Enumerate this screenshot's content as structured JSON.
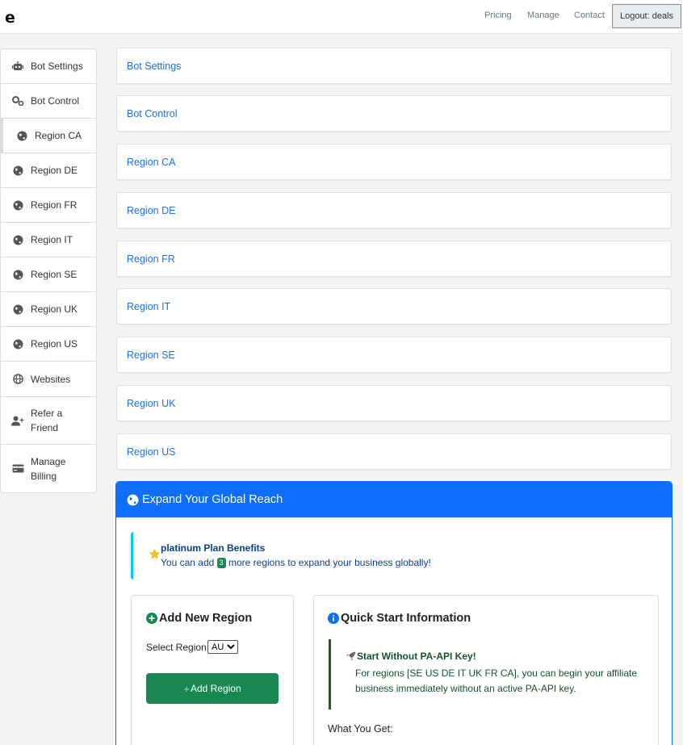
{
  "nav": {
    "logo": "e",
    "links": [
      "Pricing",
      "Manage",
      "Contact"
    ],
    "logout_label": "Logout: deals"
  },
  "sidebar": {
    "items": [
      {
        "label": "Bot Settings",
        "icon": "robot-icon"
      },
      {
        "label": "Bot Control",
        "icon": "gears-icon"
      },
      {
        "label": "Region CA",
        "icon": "globe-icon"
      },
      {
        "label": "Region DE",
        "icon": "globe-icon"
      },
      {
        "label": "Region FR",
        "icon": "globe-icon"
      },
      {
        "label": "Region IT",
        "icon": "globe-icon"
      },
      {
        "label": "Region SE",
        "icon": "globe-icon"
      },
      {
        "label": "Region UK",
        "icon": "globe-icon"
      },
      {
        "label": "Region US",
        "icon": "globe-icon"
      },
      {
        "label": "Websites",
        "icon": "world-grid-icon"
      },
      {
        "label": "Refer a Friend",
        "icon": "user-plus-icon"
      },
      {
        "label": "Manage Billing",
        "icon": "credit-card-icon"
      }
    ]
  },
  "cards": [
    "Bot Settings",
    "Bot Control",
    "Region CA",
    "Region DE",
    "Region FR",
    "Region IT",
    "Region SE",
    "Region UK",
    "Region US"
  ],
  "expand": {
    "title": "Expand Your Global Reach",
    "benefit_title": "platinum Plan Benefits",
    "benefit_pre": "You can add",
    "benefit_count": "3",
    "benefit_post": "more regions to expand your business globally!",
    "add_title": "Add New Region",
    "select_label": "Select Region",
    "select_value": "AU",
    "add_button": "Add Region",
    "quick_title": "Quick Start Information",
    "note_title": "Start Without PA-API Key!",
    "note_text": "For regions [SE US DE IT UK FR CA], you can begin your affiliate business immediately without an active PA-API key.",
    "what_get": "What You Get:"
  },
  "colors": {
    "accent": "#0d6efd",
    "link": "#1a73e8",
    "success": "#198754",
    "info": "#0dcaf0"
  }
}
